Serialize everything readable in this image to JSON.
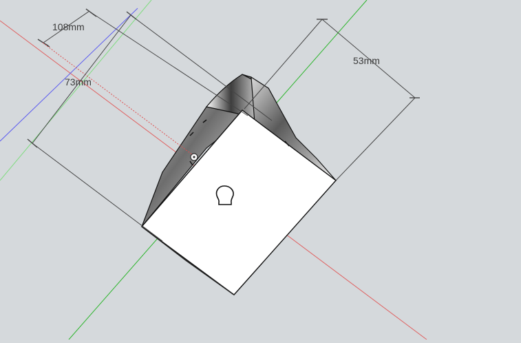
{
  "viewport": {
    "background_color": "#d5d9dc",
    "axis_colors": {
      "red": "#e06060",
      "green": "#2ab52a",
      "blue": "#5b5bf0"
    }
  },
  "dimensions": {
    "width_label": "108mm",
    "height_label": "73mm",
    "depth_label": "53mm"
  },
  "model": {
    "face_color": "#ffffff",
    "edge_color": "#111111",
    "cursor_icon": "inference-point-icon",
    "feature_icon": "keyhole-slot-icon"
  }
}
